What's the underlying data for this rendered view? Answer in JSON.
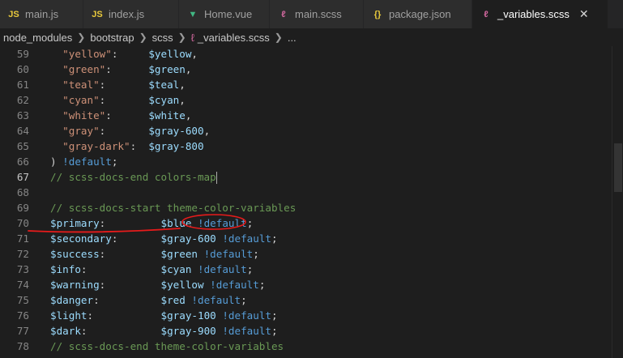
{
  "colors": {
    "background": "#1e1e1e",
    "tab_bar": "#252526",
    "string": "#ce9178",
    "variable": "#9cdcfe",
    "keyword": "#569cd6",
    "comment": "#6a9955",
    "annotation": "#e81b1b"
  },
  "tabs": [
    {
      "icon": "js-icon",
      "icon_text": "JS",
      "icon_color": "#e8c93c",
      "label": "main.js"
    },
    {
      "icon": "js-icon",
      "icon_text": "JS",
      "icon_color": "#e8c93c",
      "label": "index.js"
    },
    {
      "icon": "vue-icon",
      "icon_text": "▼",
      "icon_color": "#41b883",
      "label": "Home.vue"
    },
    {
      "icon": "sass-icon",
      "icon_text": "ℓ",
      "icon_color": "#d0679d",
      "label": "main.scss"
    },
    {
      "icon": "json-icon",
      "icon_text": "{}",
      "icon_color": "#e8c93c",
      "label": "package.json"
    },
    {
      "icon": "sass-icon",
      "icon_text": "ℓ",
      "icon_color": "#d0679d",
      "label": "_variables.scss",
      "active": true,
      "close": "✕"
    }
  ],
  "breadcrumb": {
    "items": [
      "node_modules",
      "bootstrap",
      "scss"
    ],
    "file_icon": "sass-icon",
    "file_icon_text": "ℓ",
    "file": "_variables.scss",
    "tail": "..."
  },
  "editor": {
    "lines": [
      {
        "n": "59",
        "tokens": [
          [
            "s",
            "  \"yellow\""
          ],
          [
            "p",
            ":     "
          ],
          [
            "v",
            "$yellow"
          ],
          [
            "p",
            ","
          ]
        ]
      },
      {
        "n": "60",
        "tokens": [
          [
            "s",
            "  \"green\""
          ],
          [
            "p",
            ":      "
          ],
          [
            "v",
            "$green"
          ],
          [
            "p",
            ","
          ]
        ]
      },
      {
        "n": "61",
        "tokens": [
          [
            "s",
            "  \"teal\""
          ],
          [
            "p",
            ":       "
          ],
          [
            "v",
            "$teal"
          ],
          [
            "p",
            ","
          ]
        ]
      },
      {
        "n": "62",
        "tokens": [
          [
            "s",
            "  \"cyan\""
          ],
          [
            "p",
            ":       "
          ],
          [
            "v",
            "$cyan"
          ],
          [
            "p",
            ","
          ]
        ]
      },
      {
        "n": "63",
        "tokens": [
          [
            "s",
            "  \"white\""
          ],
          [
            "p",
            ":      "
          ],
          [
            "v",
            "$white"
          ],
          [
            "p",
            ","
          ]
        ]
      },
      {
        "n": "64",
        "tokens": [
          [
            "s",
            "  \"gray\""
          ],
          [
            "p",
            ":       "
          ],
          [
            "v",
            "$gray-600"
          ],
          [
            "p",
            ","
          ]
        ]
      },
      {
        "n": "65",
        "tokens": [
          [
            "s",
            "  \"gray-dark\""
          ],
          [
            "p",
            ":  "
          ],
          [
            "v",
            "$gray-800"
          ]
        ]
      },
      {
        "n": "66",
        "tokens": [
          [
            "p",
            ") "
          ],
          [
            "k",
            "!default"
          ],
          [
            "p",
            ";"
          ]
        ]
      },
      {
        "n": "67",
        "tokens": [
          [
            "c",
            "// scss-docs-end colors-map"
          ]
        ],
        "current": true,
        "cursor": true
      },
      {
        "n": "68",
        "tokens": []
      },
      {
        "n": "69",
        "tokens": [
          [
            "c",
            "// scss-docs-start theme-color-variables"
          ]
        ]
      },
      {
        "n": "70",
        "tokens": [
          [
            "v",
            "$primary"
          ],
          [
            "p",
            ":         "
          ],
          [
            "v",
            "$blue"
          ],
          [
            "p",
            " "
          ],
          [
            "k",
            "!default"
          ],
          [
            "p",
            ";"
          ]
        ]
      },
      {
        "n": "71",
        "tokens": [
          [
            "v",
            "$secondary"
          ],
          [
            "p",
            ":       "
          ],
          [
            "v",
            "$gray-600"
          ],
          [
            "p",
            " "
          ],
          [
            "k",
            "!default"
          ],
          [
            "p",
            ";"
          ]
        ]
      },
      {
        "n": "72",
        "tokens": [
          [
            "v",
            "$success"
          ],
          [
            "p",
            ":         "
          ],
          [
            "v",
            "$green"
          ],
          [
            "p",
            " "
          ],
          [
            "k",
            "!default"
          ],
          [
            "p",
            ";"
          ]
        ]
      },
      {
        "n": "73",
        "tokens": [
          [
            "v",
            "$info"
          ],
          [
            "p",
            ":            "
          ],
          [
            "v",
            "$cyan"
          ],
          [
            "p",
            " "
          ],
          [
            "k",
            "!default"
          ],
          [
            "p",
            ";"
          ]
        ]
      },
      {
        "n": "74",
        "tokens": [
          [
            "v",
            "$warning"
          ],
          [
            "p",
            ":         "
          ],
          [
            "v",
            "$yellow"
          ],
          [
            "p",
            " "
          ],
          [
            "k",
            "!default"
          ],
          [
            "p",
            ";"
          ]
        ]
      },
      {
        "n": "75",
        "tokens": [
          [
            "v",
            "$danger"
          ],
          [
            "p",
            ":          "
          ],
          [
            "v",
            "$red"
          ],
          [
            "p",
            " "
          ],
          [
            "k",
            "!default"
          ],
          [
            "p",
            ";"
          ]
        ]
      },
      {
        "n": "76",
        "tokens": [
          [
            "v",
            "$light"
          ],
          [
            "p",
            ":           "
          ],
          [
            "v",
            "$gray-100"
          ],
          [
            "p",
            " "
          ],
          [
            "k",
            "!default"
          ],
          [
            "p",
            ";"
          ]
        ]
      },
      {
        "n": "77",
        "tokens": [
          [
            "v",
            "$dark"
          ],
          [
            "p",
            ":            "
          ],
          [
            "v",
            "$gray-900"
          ],
          [
            "p",
            " "
          ],
          [
            "k",
            "!default"
          ],
          [
            "p",
            ";"
          ]
        ]
      },
      {
        "n": "78",
        "tokens": [
          [
            "c",
            "// scss-docs-end theme-color-variables"
          ]
        ]
      }
    ]
  }
}
